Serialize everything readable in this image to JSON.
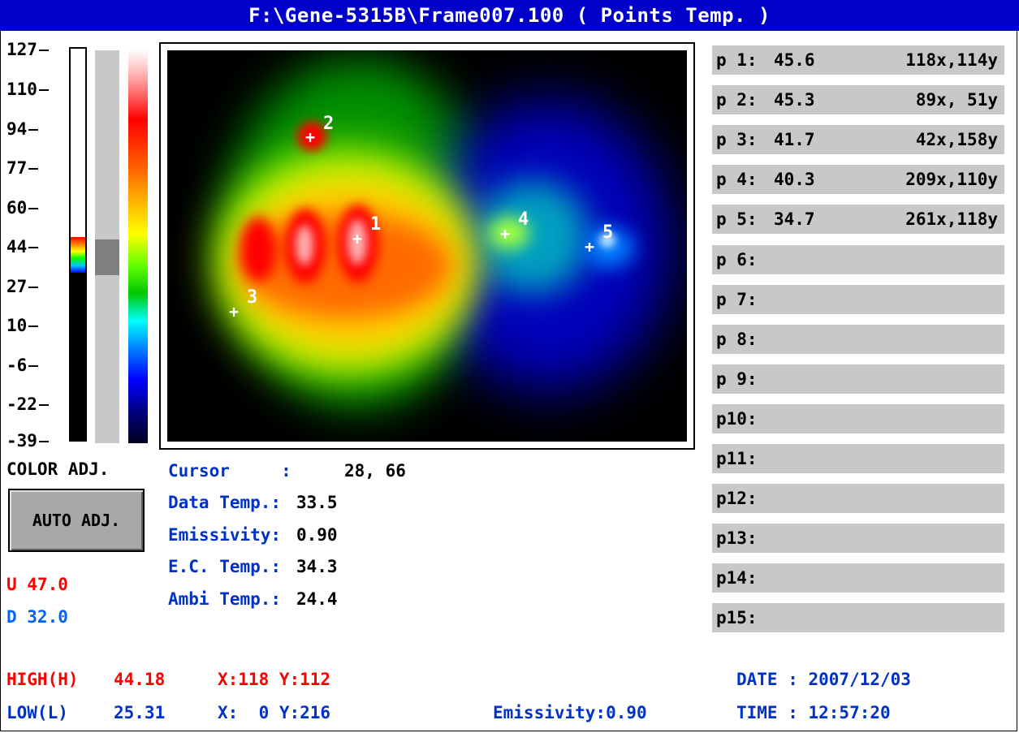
{
  "title": "F:\\Gene-5315B\\Frame007.100 ( Points Temp. )",
  "scale": {
    "ticks": [
      "127",
      "110",
      "94",
      "77",
      "60",
      "44",
      "27",
      "10",
      "-6",
      "-22",
      "-39"
    ]
  },
  "points": [
    {
      "label": "p 1:",
      "temp": "45.6",
      "coord": "118x,114y"
    },
    {
      "label": "p 2:",
      "temp": "45.3",
      "coord": " 89x, 51y"
    },
    {
      "label": "p 3:",
      "temp": "41.7",
      "coord": " 42x,158y"
    },
    {
      "label": "p 4:",
      "temp": "40.3",
      "coord": "209x,110y"
    },
    {
      "label": "p 5:",
      "temp": "34.7",
      "coord": "261x,118y"
    },
    {
      "label": "p 6:",
      "temp": "",
      "coord": ""
    },
    {
      "label": "p 7:",
      "temp": "",
      "coord": ""
    },
    {
      "label": "p 8:",
      "temp": "",
      "coord": ""
    },
    {
      "label": "p 9:",
      "temp": "",
      "coord": ""
    },
    {
      "label": "p10:",
      "temp": "",
      "coord": ""
    },
    {
      "label": "p11:",
      "temp": "",
      "coord": ""
    },
    {
      "label": "p12:",
      "temp": "",
      "coord": ""
    },
    {
      "label": "p13:",
      "temp": "",
      "coord": ""
    },
    {
      "label": "p14:",
      "temp": "",
      "coord": ""
    },
    {
      "label": "p15:",
      "temp": "",
      "coord": ""
    }
  ],
  "markers": [
    "1",
    "2",
    "3",
    "4",
    "5"
  ],
  "left_panel": {
    "color_adj": "COLOR ADJ.",
    "auto_adj": "AUTO ADJ.",
    "upper": "U 47.0",
    "lower": "D 32.0"
  },
  "info": {
    "cursor_label": "Cursor     :",
    "cursor_value": "28, 66",
    "data_label": "Data Temp.:",
    "data_value": "33.5",
    "emiss_label": "Emissivity:",
    "emiss_value": "0.90",
    "ec_label": "E.C. Temp.:",
    "ec_value": "34.3",
    "ambi_label": "Ambi Temp.:",
    "ambi_value": "24.4"
  },
  "footer": {
    "high_label": "HIGH(H)",
    "high_value": "44.18",
    "high_xy": "X:118 Y:112",
    "low_label": "LOW(L)",
    "low_value": "25.31",
    "low_xy": "X:  0 Y:216",
    "emissivity": "Emissivity:0.90",
    "date": "DATE : 2007/12/03",
    "time": "TIME : 12:57:20"
  },
  "colors": {
    "title_bg": "#0000c8",
    "accent_blue": "#0032c8",
    "high_red": "#ff0000",
    "low_blue": "#0064ff",
    "panel_gray": "#c8c8c8"
  },
  "level": {
    "upper": 47.0,
    "lower": 32.0,
    "scale_min": -39,
    "scale_max": 127
  }
}
